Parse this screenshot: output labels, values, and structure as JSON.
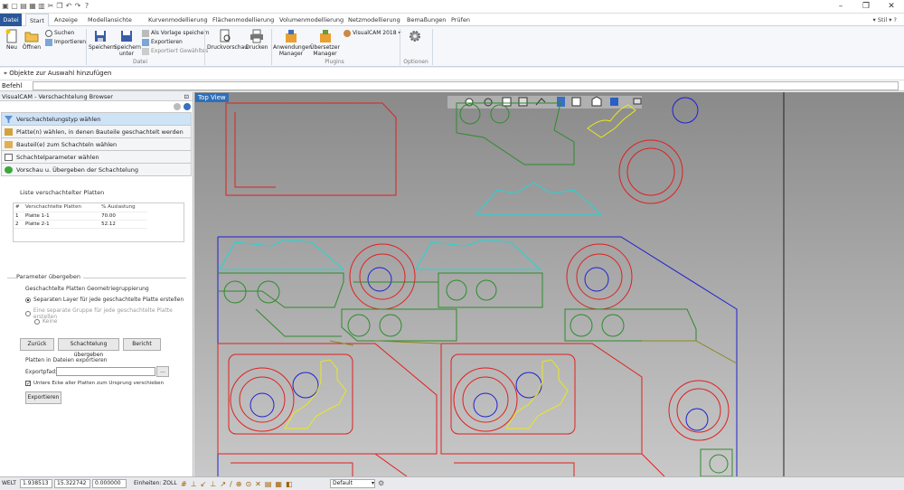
{
  "tabs": [
    {
      "label": "Datei"
    },
    {
      "label": "Start"
    },
    {
      "label": "Anzeige"
    },
    {
      "label": "Modellansichte"
    },
    {
      "label": "Kurvenmodellierung"
    },
    {
      "label": "Flächenmodellierung"
    },
    {
      "label": "Volumenmodellierung"
    },
    {
      "label": "Netzmodellierung"
    },
    {
      "label": "Bemaßungen"
    },
    {
      "label": "Prüfen"
    }
  ],
  "style_label": "Stil",
  "ribbon": {
    "neu": "Neu",
    "oeffnen": "Öffnen",
    "suchen": "Suchen",
    "importieren": "Importieren",
    "speichern": "Speichern",
    "speichern_unter": "Speichern unter",
    "als_vorlage": "Als Vorlage speichern",
    "exportieren": "Exportieren",
    "exportiert_gewaehltes": "Exportiert Gewähltes",
    "druckvorschau": "Druckvorschau",
    "drucken": "Drucken",
    "anwendungen": "Anwendungen Manager",
    "uebersetzer": "Übersetzer Manager",
    "visualcam": "VisualCAM 2018",
    "group_datei": "Datei",
    "group_plugins": "Plugins",
    "group_optionen": "Optionen"
  },
  "prompt": "Objekte zur Auswahl hinzufügen",
  "command_label": "Befehl",
  "panel": {
    "title": "VisualCAM - Verschachtelung Browser",
    "steps": [
      "Verschachtelungstyp wählen",
      "Platte(n) wählen, in denen Bauteile geschachtelt werden sollen",
      "Bauteil(e) zum Schachteln wählen",
      "Schachtelparameter wählen",
      "Vorschau u. Übergeben der Schachtelung"
    ],
    "list_title": "Liste verschachtelter Platten",
    "col_num": "#",
    "col_name": "Verschachtelte Platten",
    "col_pct": "% Auslastung",
    "rows": [
      {
        "num": "1",
        "name": "Platte 1-1",
        "pct": "70.00"
      },
      {
        "num": "2",
        "name": "Platte 2-1",
        "pct": "52.12"
      }
    ],
    "params_title": "Parameter übergeben",
    "geo_title": "Geschachtelte Platten Geometriegruppierung",
    "opt1": "Separaten Layer für jede geschachtelte Platte erstellen",
    "opt2": "Eine separate Gruppe für jede geschachtelte Platte erstellen",
    "opt3": "Keine",
    "btn_back": "Zurück",
    "btn_commit": "Schachtelung übergeben",
    "btn_report": "Bericht",
    "export_title": "Platten in Dateien exportieren",
    "export_path_label": "Exportpfad:",
    "export_path_value": "",
    "browse": "...",
    "move_origin": "Untere Ecke aller Platten zum Ursprung verschieben",
    "btn_export": "Exportieren"
  },
  "viewport": {
    "label": "Top View",
    "colors": {
      "red": "#e02020",
      "green": "#2e8b2e",
      "cyan": "#22d6d6",
      "blue": "#2020d0",
      "yellow": "#e8e820"
    }
  },
  "status": {
    "units_mode": "WELT",
    "x": "1.938513",
    "y": "15.322742",
    "z": "0.000000",
    "units": "Einheiten: ZOLL",
    "layer": "Default"
  }
}
